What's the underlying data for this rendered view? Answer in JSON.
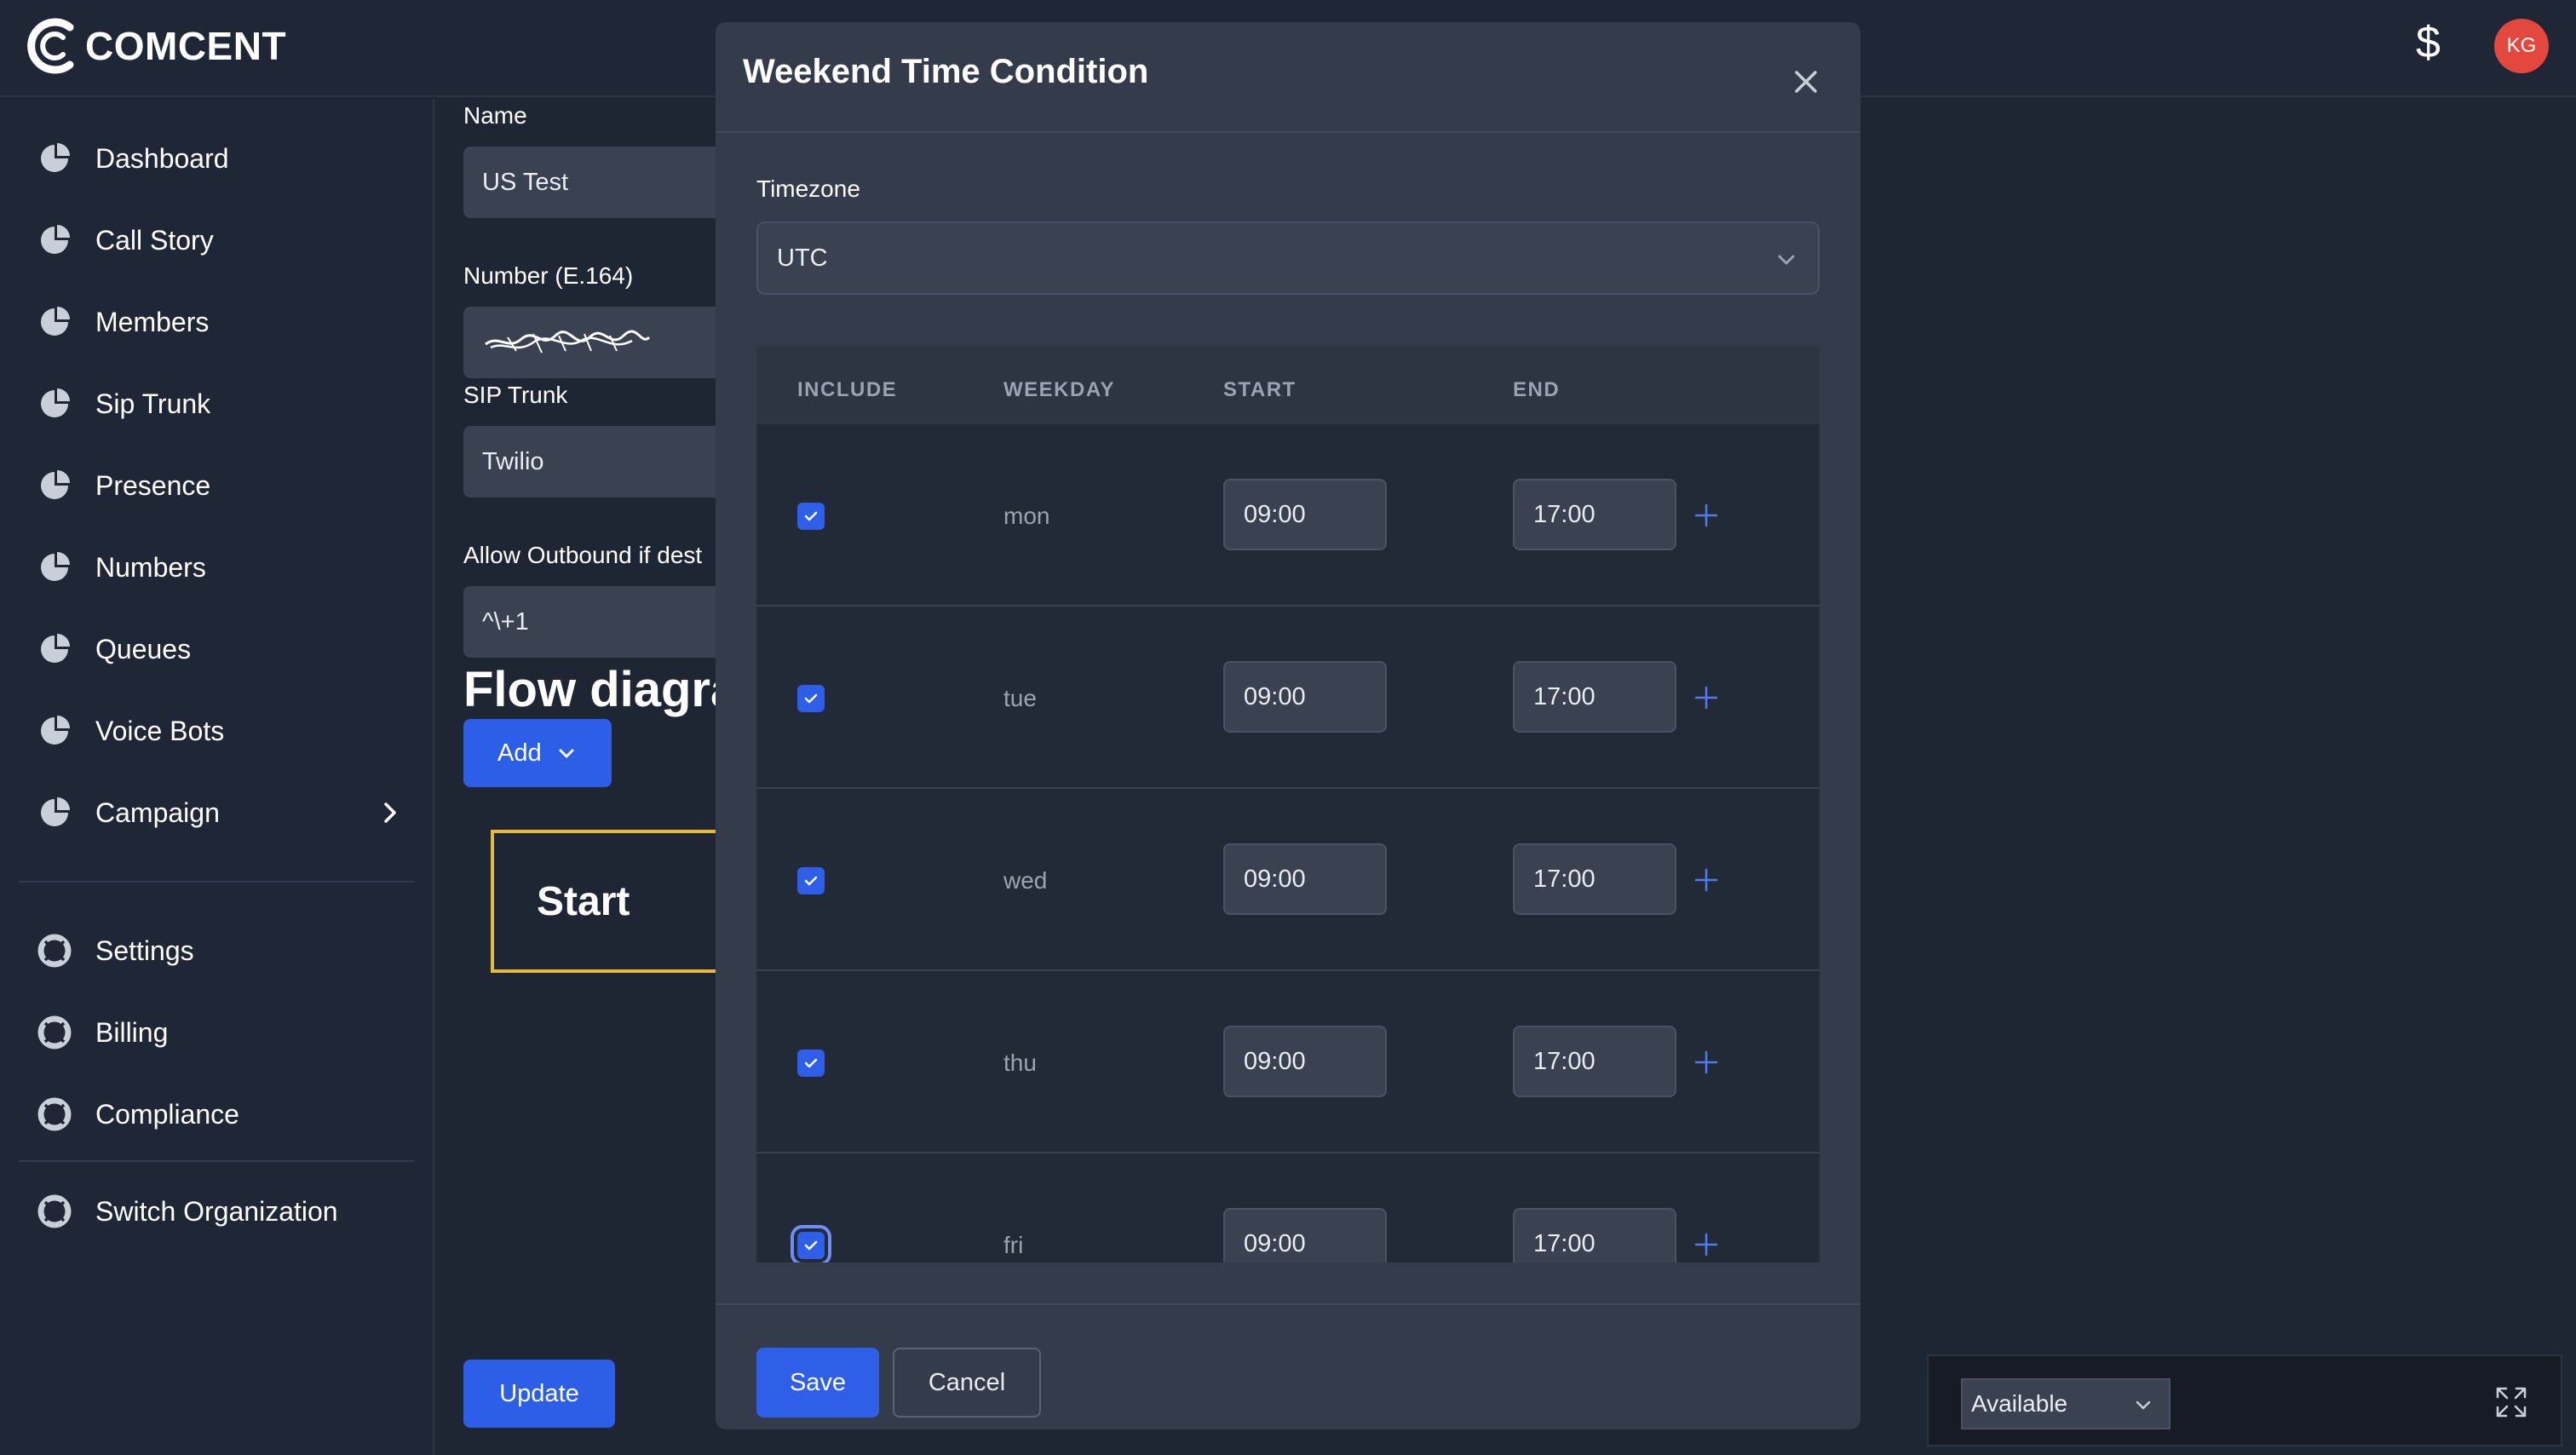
{
  "brand": {
    "name": "COMCENT"
  },
  "header": {
    "currency_symbol": "$",
    "avatar_initials": "KG"
  },
  "sidebar": {
    "items": [
      {
        "label": "Dashboard",
        "icon": "pie-chart-icon"
      },
      {
        "label": "Call Story",
        "icon": "pie-chart-icon"
      },
      {
        "label": "Members",
        "icon": "pie-chart-icon"
      },
      {
        "label": "Sip Trunk",
        "icon": "pie-chart-icon"
      },
      {
        "label": "Presence",
        "icon": "pie-chart-icon"
      },
      {
        "label": "Numbers",
        "icon": "pie-chart-icon"
      },
      {
        "label": "Queues",
        "icon": "pie-chart-icon"
      },
      {
        "label": "Voice Bots",
        "icon": "pie-chart-icon"
      },
      {
        "label": "Campaign",
        "icon": "pie-chart-icon"
      }
    ],
    "secondary": [
      {
        "label": "Settings",
        "icon": "lifebuoy-icon"
      },
      {
        "label": "Billing",
        "icon": "lifebuoy-icon"
      },
      {
        "label": "Compliance",
        "icon": "lifebuoy-icon"
      }
    ],
    "tertiary": [
      {
        "label": "Switch Organization",
        "icon": "lifebuoy-icon"
      }
    ]
  },
  "form": {
    "name_label": "Name",
    "name_value": "US Test",
    "number_label": "Number (E.164)",
    "sip_label": "SIP Trunk",
    "sip_value": "Twilio",
    "outbound_label": "Allow Outbound if dest",
    "outbound_value": "^\\+1",
    "flow_title": "Flow diagra",
    "add_label": "Add",
    "start_label": "Start",
    "update_label": "Update"
  },
  "modal": {
    "title": "Weekend Time Condition",
    "timezone_label": "Timezone",
    "timezone_value": "UTC",
    "columns": {
      "include": "INCLUDE",
      "weekday": "WEEKDAY",
      "start": "START",
      "end": "END"
    },
    "rows": [
      {
        "day": "mon",
        "start": "09:00",
        "end": "17:00",
        "included": true
      },
      {
        "day": "tue",
        "start": "09:00",
        "end": "17:00",
        "included": true
      },
      {
        "day": "wed",
        "start": "09:00",
        "end": "17:00",
        "included": true
      },
      {
        "day": "thu",
        "start": "09:00",
        "end": "17:00",
        "included": true
      },
      {
        "day": "fri",
        "start": "09:00",
        "end": "17:00",
        "included": true
      }
    ],
    "save_label": "Save",
    "cancel_label": "Cancel"
  },
  "status": {
    "value": "Available"
  },
  "colors": {
    "accent": "#2f5fe8",
    "start_border": "#e6b93a",
    "avatar": "#e4473d"
  }
}
